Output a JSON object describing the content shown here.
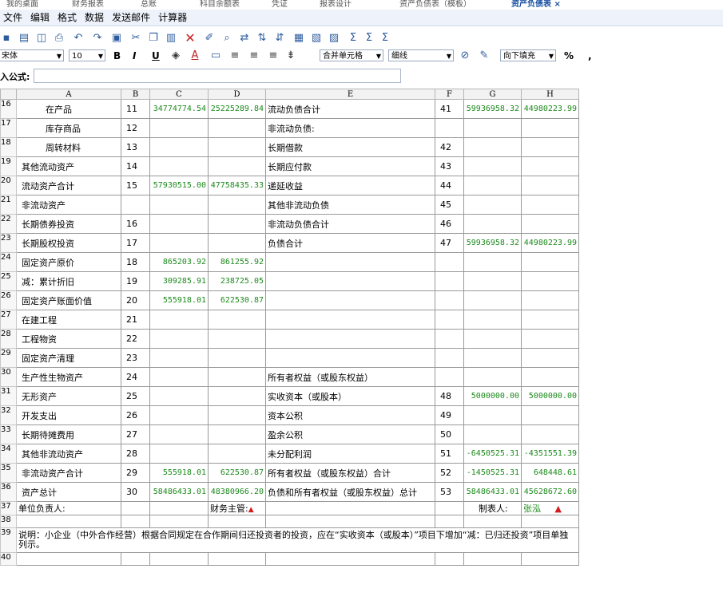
{
  "tabs": [
    "我的桌面",
    "财务报表",
    "总账",
    "科目余额表",
    "凭证",
    "报表设计",
    "资产负债表（模板）",
    "资产负债表 ×"
  ],
  "menu": [
    "文件",
    "编辑",
    "格式",
    "数据",
    "发送邮件",
    "计算器"
  ],
  "toolbar": {
    "font": "宋体",
    "size": "10",
    "bold": "B",
    "italic": "I",
    "underline": "U",
    "merge": "合并单元格",
    "border": "细线",
    "fill": "向下填充",
    "percent": "%",
    "comma": ","
  },
  "formula_label": "入公式:",
  "columns": [
    "A",
    "B",
    "C",
    "D",
    "E",
    "F",
    "G",
    "H"
  ],
  "rows": [
    {
      "rn": "16",
      "a": "在产品",
      "b": "11",
      "c": "34774774.54",
      "d": "25225289.84",
      "e": "流动负债合计",
      "f": "41",
      "g": "59936958.32",
      "h": "44980223.99"
    },
    {
      "rn": "17",
      "a": "库存商品",
      "b": "12",
      "c": "",
      "d": "",
      "e": "非流动负债:",
      "f": "",
      "g": "",
      "h": ""
    },
    {
      "rn": "18",
      "a": "周转材料",
      "b": "13",
      "c": "",
      "d": "",
      "e": "长期借款",
      "f": "42",
      "g": "",
      "h": ""
    },
    {
      "rn": "19",
      "a": "其他流动资产",
      "b": "14",
      "c": "",
      "d": "",
      "e": "长期应付款",
      "f": "43",
      "g": "",
      "h": ""
    },
    {
      "rn": "20",
      "a": "流动资产合计",
      "b": "15",
      "c": "57930515.00",
      "d": "47758435.33",
      "e": "递延收益",
      "f": "44",
      "g": "",
      "h": ""
    },
    {
      "rn": "21",
      "a": "非流动资产",
      "b": "",
      "c": "",
      "d": "",
      "e": "其他非流动负债",
      "f": "45",
      "g": "",
      "h": ""
    },
    {
      "rn": "22",
      "a": "长期债券投资",
      "b": "16",
      "c": "",
      "d": "",
      "e": "非流动负债合计",
      "f": "46",
      "g": "",
      "h": ""
    },
    {
      "rn": "23",
      "a": "长期股权投资",
      "b": "17",
      "c": "",
      "d": "",
      "e": "负债合计",
      "f": "47",
      "g": "59936958.32",
      "h": "44980223.99"
    },
    {
      "rn": "24",
      "a": "固定资产原价",
      "b": "18",
      "c": "865203.92",
      "d": "861255.92",
      "e": "",
      "f": "",
      "g": "",
      "h": ""
    },
    {
      "rn": "25",
      "a": "减：累计折旧",
      "b": "19",
      "c": "309285.91",
      "d": "238725.05",
      "e": "",
      "f": "",
      "g": "",
      "h": ""
    },
    {
      "rn": "26",
      "a": "固定资产账面价值",
      "b": "20",
      "c": "555918.01",
      "d": "622530.87",
      "e": "",
      "f": "",
      "g": "",
      "h": ""
    },
    {
      "rn": "27",
      "a": "在建工程",
      "b": "21",
      "c": "",
      "d": "",
      "e": "",
      "f": "",
      "g": "",
      "h": ""
    },
    {
      "rn": "28",
      "a": "工程物资",
      "b": "22",
      "c": "",
      "d": "",
      "e": "",
      "f": "",
      "g": "",
      "h": ""
    },
    {
      "rn": "29",
      "a": "固定资产清理",
      "b": "23",
      "c": "",
      "d": "",
      "e": "",
      "f": "",
      "g": "",
      "h": ""
    },
    {
      "rn": "30",
      "a": "生产性生物资产",
      "b": "24",
      "c": "",
      "d": "",
      "e": "所有者权益（或股东权益）",
      "f": "",
      "g": "",
      "h": ""
    },
    {
      "rn": "31",
      "a": "无形资产",
      "b": "25",
      "c": "",
      "d": "",
      "e": "实收资本（或股本）",
      "f": "48",
      "g": "5000000.00",
      "h": "5000000.00"
    },
    {
      "rn": "32",
      "a": "开发支出",
      "b": "26",
      "c": "",
      "d": "",
      "e": "资本公积",
      "f": "49",
      "g": "",
      "h": ""
    },
    {
      "rn": "33",
      "a": "长期待摊费用",
      "b": "27",
      "c": "",
      "d": "",
      "e": "盈余公积",
      "f": "50",
      "g": "",
      "h": ""
    },
    {
      "rn": "34",
      "a": "其他非流动资产",
      "b": "28",
      "c": "",
      "d": "",
      "e": "未分配利润",
      "f": "51",
      "g": "-6450525.31",
      "h": "-4351551.39"
    },
    {
      "rn": "35",
      "a": "非流动资产合计",
      "b": "29",
      "c": "555918.01",
      "d": "622530.87",
      "e": "所有者权益（或股东权益）合计",
      "f": "52",
      "g": "-1450525.31",
      "h": "648448.61"
    },
    {
      "rn": "36",
      "a": "资产总计",
      "b": "30",
      "c": "58486433.01",
      "d": "48380966.20",
      "e": "负债和所有者权益（或股东权益）总计",
      "f": "53",
      "g": "58486433.01",
      "h": "45628672.60"
    }
  ],
  "footer": {
    "rn37": "37",
    "principal_label": "单位负责人:",
    "finance_label": "财务主管:",
    "preparer_label": "制表人:",
    "preparer_name": "张泓",
    "rn38": "38",
    "rn39": "39",
    "note": "说明：小企业（中外合作经营）根据合同规定在合作期间归还投资者的投资，应在“实收资本（或股本）”项目下增加“减：已归还投资”项目单独列示。",
    "rn40": "40"
  }
}
